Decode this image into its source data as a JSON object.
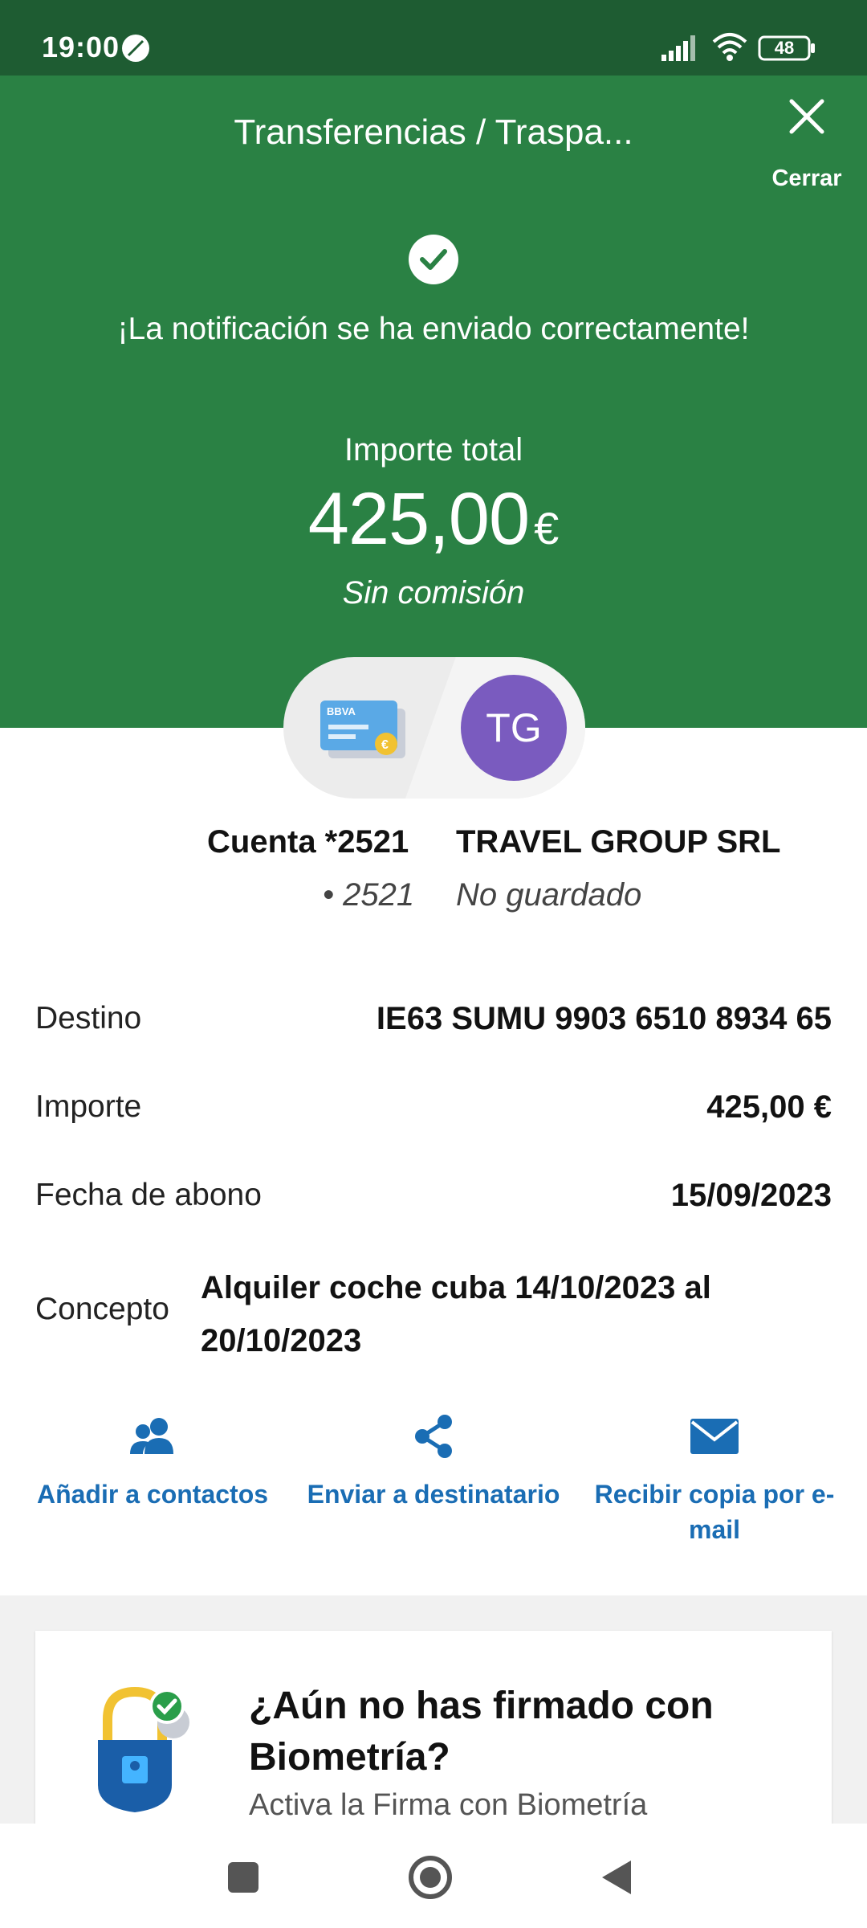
{
  "status_bar": {
    "time": "19:00",
    "battery": "48"
  },
  "header": {
    "title": "Transferencias / Traspa...",
    "close_label": "Cerrar",
    "notification": "¡La notificación se ha enviado correctamente!",
    "total_label": "Importe total",
    "total_amount": "425,00",
    "currency": "€",
    "fee": "Sin comisión"
  },
  "transfer": {
    "card_brand": "BBVA",
    "avatar_initials": "TG",
    "origin_name": "Cuenta *2521",
    "origin_sub": "• 2521",
    "recipient_name": "TRAVEL GROUP SRL",
    "recipient_sub": "No guardado"
  },
  "details": [
    {
      "label": "Destino",
      "value": "IE63 SUMU 9903 6510 8934 65"
    },
    {
      "label": "Importe",
      "value": "425,00 €"
    },
    {
      "label": "Fecha de abono",
      "value": "15/09/2023"
    },
    {
      "label": "Concepto",
      "value": "Alquiler coche cuba 14/10/2023 al 20/10/2023"
    }
  ],
  "actions": [
    {
      "label": "Añadir a contactos",
      "icon": "contacts-icon"
    },
    {
      "label": "Enviar a destinatario",
      "icon": "share-icon"
    },
    {
      "label": "Recibir copia por e-mail",
      "icon": "mail-icon"
    }
  ],
  "biometrics": {
    "title": "¿Aún no has firmado con Biometría?",
    "subtitle": "Activa la Firma con Biometría"
  },
  "colors": {
    "header_green": "#2a8144",
    "status_green": "#1e5c32",
    "action_blue": "#1a6db4",
    "avatar_purple": "#7a5bbf"
  }
}
